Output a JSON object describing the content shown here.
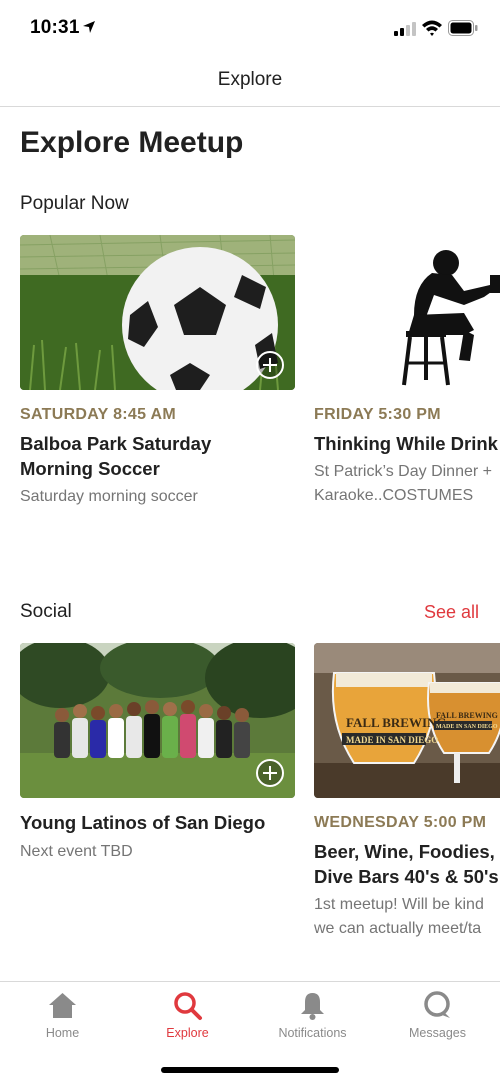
{
  "status_bar": {
    "time": "10:31"
  },
  "nav": {
    "title": "Explore"
  },
  "page": {
    "heading": "Explore Meetup"
  },
  "sections": {
    "popular": {
      "title": "Popular Now",
      "cards": [
        {
          "date": "SATURDAY 8:45 AM",
          "title_line1": "Balboa Park Saturday",
          "title_line2": "Morning Soccer",
          "desc_line1": "Saturday morning soccer",
          "image": "soccer-ball-photo"
        },
        {
          "date": "FRIDAY 5:30 PM",
          "title_line1": "Thinking While Drink",
          "desc_line1": "St Patrick’s Day Dinner +",
          "desc_line2": "Karaoke..COSTUMES",
          "image": "thinker-silhouette"
        }
      ]
    },
    "social": {
      "title": "Social",
      "see_all": "See all",
      "cards": [
        {
          "title_line1": "Young Latinos of San Diego",
          "desc_line1": "Next event TBD",
          "image": "group-photo"
        },
        {
          "date": "WEDNESDAY 5:00 PM",
          "title_line1": "Beer, Wine, Foodies,",
          "title_line2": "Dive Bars 40's & 50's",
          "desc_line1": "1st meetup! Will be kind",
          "desc_line2": "we can actually meet/ta",
          "image": "beer-glasses-photo",
          "glass_text_line1": "FALL BREWING",
          "glass_text_line2": "MADE IN SAN DIEGO"
        }
      ]
    }
  },
  "tabs": [
    {
      "label": "Home",
      "icon": "home-icon",
      "active": false
    },
    {
      "label": "Explore",
      "icon": "search-icon",
      "active": true
    },
    {
      "label": "Notifications",
      "icon": "bell-icon",
      "active": false
    },
    {
      "label": "Messages",
      "icon": "chat-bubble-icon",
      "active": false
    }
  ],
  "colors": {
    "accent": "#e0393e",
    "date": "#8c7a55",
    "text": "#212121",
    "muted": "#757575"
  }
}
